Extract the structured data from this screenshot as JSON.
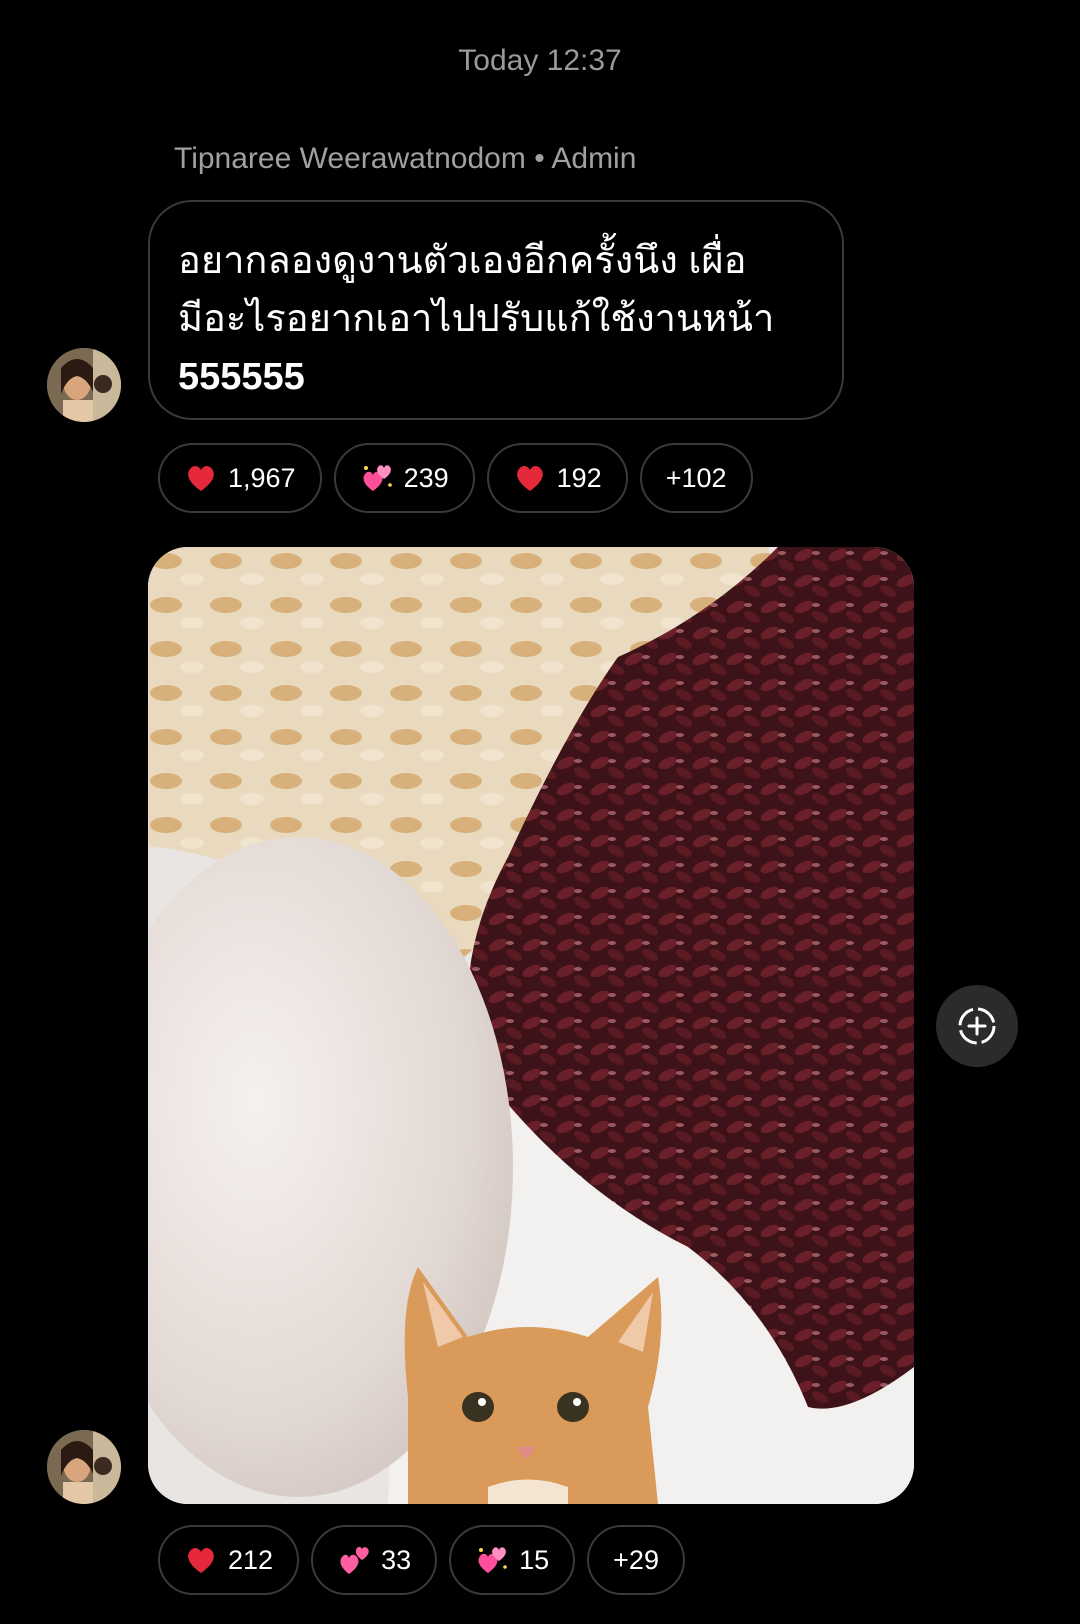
{
  "conversation": {
    "timestamp": "Today 12:37",
    "sender_line": "Tipnaree Weerawatnodom • Admin"
  },
  "message": {
    "lines": [
      "อยากลองดูงานตัวเองอีกครั้งนึง เผื่อ",
      "มีอะไรอยากเอาไปปรับแก้ใช้งานหน้า",
      "555555"
    ]
  },
  "message_reactions": [
    {
      "icon": "red-heart-icon",
      "count": "1,967"
    },
    {
      "icon": "two-hearts-sparkle-icon",
      "count": "239"
    },
    {
      "icon": "red-heart-icon",
      "count": "192"
    },
    {
      "more": "+102"
    }
  ],
  "photo": {
    "icon": "photo-image"
  },
  "photo_reactions": [
    {
      "icon": "red-heart-icon",
      "count": "212"
    },
    {
      "icon": "two-hearts-icon",
      "count": "33"
    },
    {
      "icon": "two-hearts-sparkle-icon",
      "count": "15"
    },
    {
      "more": "+29"
    }
  ],
  "actions": {
    "share_icon": "add-circle-icon"
  },
  "colors": {
    "background": "#000000",
    "bubble_border": "#3a3a3a",
    "muted_text": "#9a9a9a",
    "heart_red": "#e5293b",
    "pink_heart": "#ff5fa0"
  }
}
